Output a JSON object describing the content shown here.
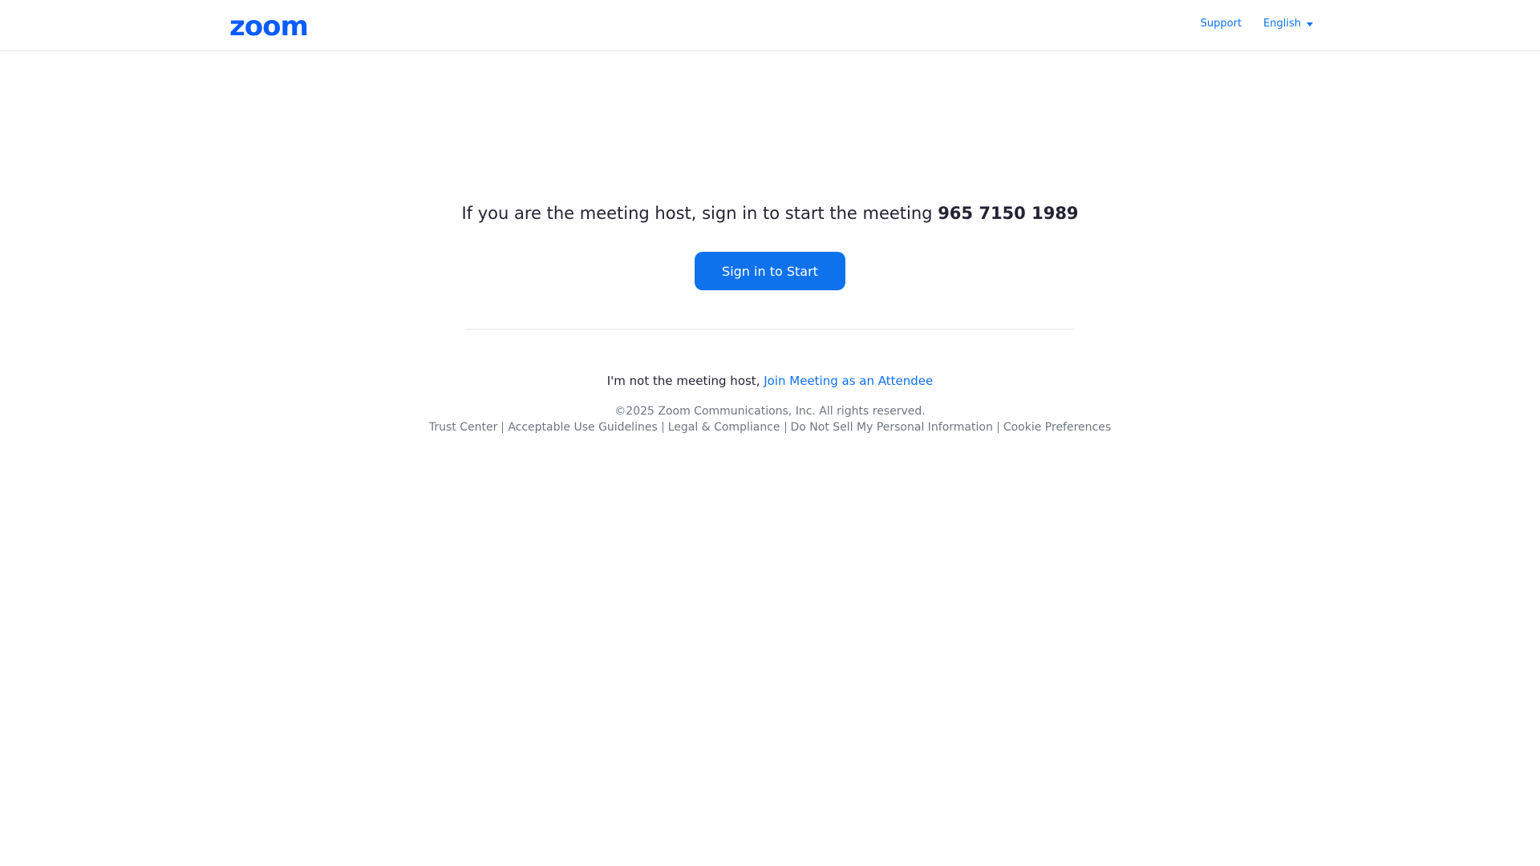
{
  "header": {
    "logo_text": "zoom",
    "support_label": "Support",
    "language_label": "English"
  },
  "main": {
    "headline_prefix": "If you are the meeting host, sign in to start the meeting",
    "meeting_id": "965 7150 1989",
    "start_button_label": "Sign in to Start",
    "attendee_prefix": "I'm not the meeting host,",
    "attendee_link_label": "Join Meeting as an Attendee"
  },
  "footer": {
    "copyright": "©2025 Zoom Communications, Inc. All rights reserved.",
    "links": [
      "Trust Center",
      "Acceptable Use Guidelines",
      "Legal & Compliance",
      "Do Not Sell My Personal Information",
      "Cookie Preferences"
    ]
  },
  "colors": {
    "brand": "#0b5cff",
    "link": "#0e72ed",
    "muted": "#6e7680"
  }
}
